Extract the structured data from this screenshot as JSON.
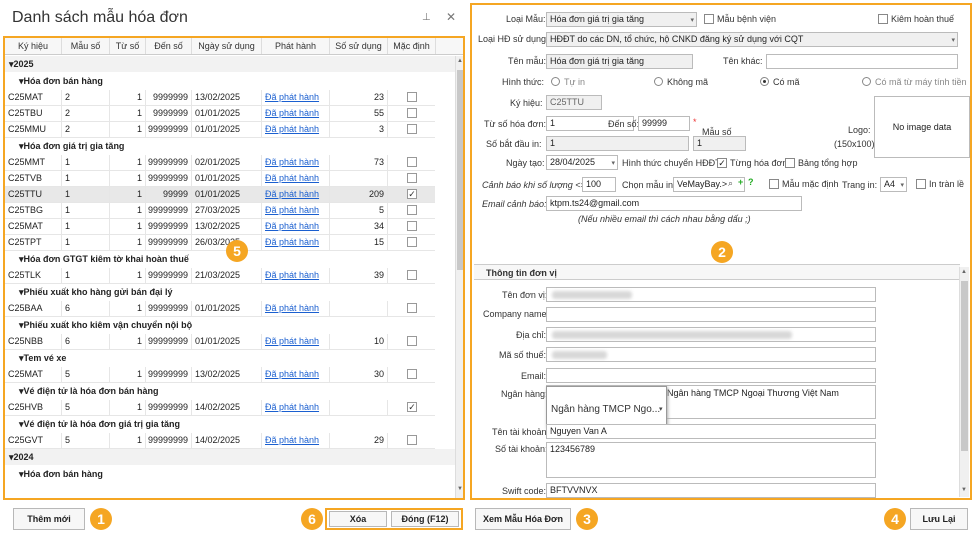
{
  "left": {
    "title": "Danh sách mẫu hóa đơn",
    "headers": [
      "Ký hiệu",
      "Mẫu số",
      "Từ số",
      "Đến số",
      "Ngày sử dụng",
      "Phát hành",
      "Số sử dụng",
      "Mặc định"
    ],
    "years": [
      "2025",
      "2024"
    ],
    "groups": [
      {
        "name": "Hóa đơn bán hàng",
        "rows": [
          {
            "kh": "C25MAT",
            "ms": "2",
            "tu": "1",
            "den": "9999999",
            "ngay": "13/02/2025",
            "ph": "Đã phát hành",
            "sd": "23",
            "md": false
          },
          {
            "kh": "C25TBU",
            "ms": "2",
            "tu": "1",
            "den": "9999999",
            "ngay": "01/01/2025",
            "ph": "Đã phát hành",
            "sd": "55",
            "md": false
          },
          {
            "kh": "C25MMU",
            "ms": "2",
            "tu": "1",
            "den": "99999999",
            "ngay": "01/01/2025",
            "ph": "Đã phát hành",
            "sd": "3",
            "md": false
          }
        ]
      },
      {
        "name": "Hóa đơn giá trị gia tăng",
        "rows": [
          {
            "kh": "C25MMT",
            "ms": "1",
            "tu": "1",
            "den": "99999999",
            "ngay": "02/01/2025",
            "ph": "Đã phát hành",
            "sd": "73",
            "md": false
          },
          {
            "kh": "C25TVB",
            "ms": "1",
            "tu": "1",
            "den": "99999999",
            "ngay": "01/01/2025",
            "ph": "Đã phát hành",
            "sd": "",
            "md": false
          },
          {
            "kh": "C25TTU",
            "ms": "1",
            "tu": "1",
            "den": "99999",
            "ngay": "01/01/2025",
            "ph": "Đã phát hành",
            "sd": "209",
            "md": true
          },
          {
            "kh": "C25TBG",
            "ms": "1",
            "tu": "1",
            "den": "99999999",
            "ngay": "27/03/2025",
            "ph": "Đã phát hành",
            "sd": "5",
            "md": false
          },
          {
            "kh": "C25MAT",
            "ms": "1",
            "tu": "1",
            "den": "99999999",
            "ngay": "13/02/2025",
            "ph": "Đã phát hành",
            "sd": "34",
            "md": false
          },
          {
            "kh": "C25TPT",
            "ms": "1",
            "tu": "1",
            "den": "99999999",
            "ngay": "26/03/2025",
            "ph": "Đã phát hành",
            "sd": "15",
            "md": false
          }
        ]
      },
      {
        "name": "Hóa đơn GTGT kiêm tờ khai hoàn thuế",
        "rows": [
          {
            "kh": "C25TLK",
            "ms": "1",
            "tu": "1",
            "den": "99999999",
            "ngay": "21/03/2025",
            "ph": "Đã phát hành",
            "sd": "39",
            "md": false
          }
        ]
      },
      {
        "name": "Phiếu xuất kho hàng gửi bán đại lý",
        "rows": [
          {
            "kh": "C25BAA",
            "ms": "6",
            "tu": "1",
            "den": "99999999",
            "ngay": "01/01/2025",
            "ph": "Đã phát hành",
            "sd": "",
            "md": false
          }
        ]
      },
      {
        "name": "Phiếu xuất kho kiêm vận chuyển nội bộ",
        "rows": [
          {
            "kh": "C25NBB",
            "ms": "6",
            "tu": "1",
            "den": "99999999",
            "ngay": "01/01/2025",
            "ph": "Đã phát hành",
            "sd": "10",
            "md": false
          }
        ]
      },
      {
        "name": "Tem vé xe",
        "rows": [
          {
            "kh": "C25MAT",
            "ms": "5",
            "tu": "1",
            "den": "99999999",
            "ngay": "13/02/2025",
            "ph": "Đã phát hành",
            "sd": "30",
            "md": false
          }
        ]
      },
      {
        "name": "Vé điện tử là hóa đơn bán hàng",
        "rows": [
          {
            "kh": "C25HVB",
            "ms": "5",
            "tu": "1",
            "den": "99999999",
            "ngay": "14/02/2025",
            "ph": "Đã phát hành",
            "sd": "",
            "md": true
          }
        ]
      },
      {
        "name": "Vé điện tử là hóa đơn giá trị gia tăng",
        "rows": [
          {
            "kh": "C25GVT",
            "ms": "5",
            "tu": "1",
            "den": "99999999",
            "ngay": "14/02/2025",
            "ph": "Đã phát hành",
            "sd": "29",
            "md": false
          }
        ]
      }
    ],
    "group2024": "Hóa đơn bán hàng",
    "btn_add": "Thêm mới",
    "btn_delete": "Xóa",
    "btn_close": "Đóng (F12)"
  },
  "form": {
    "loai_mau_label": "Loại Mẫu:",
    "loai_mau_value": "Hóa đơn giá trị gia tăng",
    "mau_benh_vien": "Mẫu bệnh viện",
    "kiem_hoan_thue": "Kiêm hoàn thuế",
    "loai_hd_label": "Loại HĐ sử dụng:",
    "loai_hd_value": "HĐĐT do các DN, tổ chức, hộ CNKD đăng ký sử dụng với CQT",
    "ten_mau_label": "Tên mẫu:",
    "ten_mau_value": "Hóa đơn giá trị gia tăng",
    "ten_khac_label": "Tên khác:",
    "hinh_thuc_label": "Hình thức:",
    "opt_tu_in": "Tự in",
    "opt_khong_ma": "Không mã",
    "opt_co_ma": "Có mã",
    "opt_co_ma_may": "Có mã từ máy tính tiền",
    "ky_hieu_label": "Ký hiệu:",
    "ky_hieu_value": "C25TTU",
    "tu_so_label": "Từ số hóa đơn:",
    "tu_so_value": "1",
    "den_so_label": "Đến số:",
    "den_so_value": "99999",
    "required": "*",
    "mau_so_label": "Mẫu số",
    "so_bat_dau_label": "Số bắt đầu in:",
    "so_bat_dau_value": "1",
    "mau_so_value": "1",
    "logo_label": "Logo:",
    "logo_size": "(150x100)",
    "no_image": "No image data",
    "ngay_tao_label": "Ngày tạo:",
    "ngay_tao_value": "28/04/2025",
    "chuyen_label": "Hình thức chuyển HĐĐT:",
    "tung_hoa_don": "Từng hóa đơn",
    "bang_tong_hop": "Bảng tổng hợp",
    "canh_bao_label": "Cảnh báo khi số lượng <=",
    "canh_bao_value": "100",
    "chon_mau_label": "Chọn mẫu in:",
    "chon_mau_value": "VeMayBay.>",
    "mau_mac_dinh": "Mẫu mặc định",
    "trang_in_label": "Trang in:",
    "trang_in_value": "A4",
    "in_tran_le": "In tràn lề",
    "email_label": "Email cảnh báo:",
    "email_value": "ktpm.ts24@gmail.com",
    "email_note": "(Nếu nhiều email thì cách nhau bằng dấu ;)",
    "don_vi_title": "Thông tin đơn vị",
    "ten_don_vi": "Tên đơn vị:",
    "company_name": "Company name:",
    "dia_chi": "Địa chỉ:",
    "ma_so_thue": "Mã số thuế:",
    "email": "Email:",
    "ngan_hang": "Ngân hàng:",
    "ngan_hang_value": "Ngân hàng TMCP Ngoại Thương Việt Nam",
    "ngan_hang_popup": "Ngân hàng TMCP Ngo...",
    "ten_tai_khoan": "Tên tài khoản:",
    "ten_tai_khoan_value": "Nguyen Van A",
    "so_tai_khoan": "Số tài khoản:",
    "so_tai_khoan_value": "123456789",
    "swift_code": "Swift code:",
    "swift_code_value": "BFTVVNVX"
  },
  "bottom": {
    "xem_mau": "Xem Mẫu Hóa Đơn",
    "luu_lai": "Lưu Lại"
  },
  "badges": [
    "1",
    "2",
    "3",
    "4",
    "5",
    "6"
  ]
}
